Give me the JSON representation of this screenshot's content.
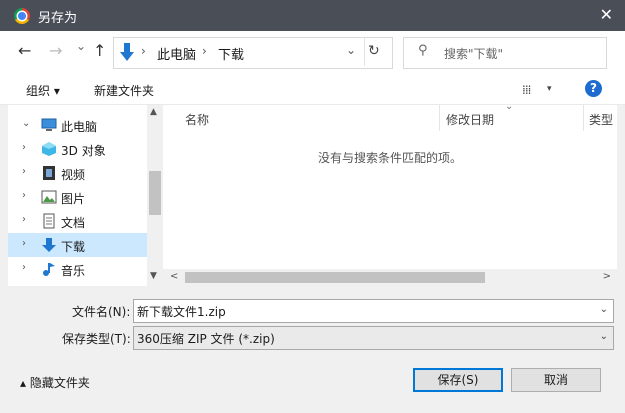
{
  "window": {
    "title": "另存为",
    "close": "✕"
  },
  "nav": {
    "back": "←",
    "forward": "→",
    "recent": "⌄",
    "up": "↑",
    "refresh": "↻"
  },
  "address": {
    "sep1": "›",
    "crumb1": "此电脑",
    "sep2": "›",
    "crumb2": "下载",
    "expand": "⌄"
  },
  "search": {
    "placeholder": "搜索\"下载\""
  },
  "toolbar": {
    "organize": "组织 ▾",
    "new_folder": "新建文件夹",
    "view_icon": "⁞⁞⁞",
    "view_caret": "▾",
    "help": "?"
  },
  "tree": [
    {
      "chevron": "⌄",
      "label": "此电脑",
      "icon": "computer-icon"
    },
    {
      "chevron": "›",
      "label": "3D 对象",
      "icon": "3d-objects-icon"
    },
    {
      "chevron": "›",
      "label": "视频",
      "icon": "video-icon"
    },
    {
      "chevron": "›",
      "label": "图片",
      "icon": "pictures-icon"
    },
    {
      "chevron": "›",
      "label": "文档",
      "icon": "document-icon"
    },
    {
      "chevron": "›",
      "label": "下载",
      "icon": "download-icon",
      "selected": true
    },
    {
      "chevron": "›",
      "label": "音乐",
      "icon": "music-icon"
    }
  ],
  "columns": {
    "name": "名称",
    "date": "修改日期",
    "type": "类型",
    "sort_caret": "⌄"
  },
  "empty_message": "没有与搜索条件匹配的项。",
  "scroll": {
    "up": "▲",
    "down": "▼",
    "left": "<",
    "right": ">"
  },
  "form": {
    "filename_label": "文件名(N):",
    "filename_value": "新下载文件1.zip",
    "type_label": "保存类型(T):",
    "type_value": "360压缩 ZIP 文件 (*.zip)",
    "dropdown": "⌄"
  },
  "footer": {
    "hide_folders": "▴ 隐藏文件夹",
    "save": "保存(S)",
    "cancel": "取消"
  },
  "colors": {
    "titlebar": "#4a4f57",
    "selected": "#cce8ff",
    "accent": "#0078d7"
  }
}
